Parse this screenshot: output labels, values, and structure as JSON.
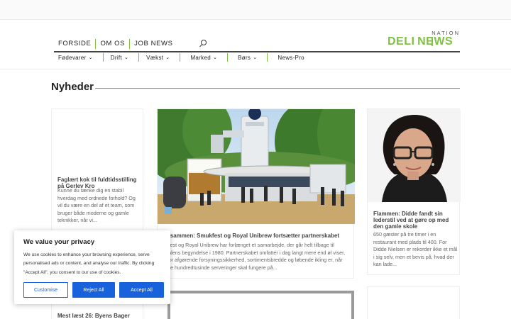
{
  "header": {
    "nav": [
      "FORSIDE",
      "OM OS",
      "JOB NEWS"
    ],
    "logo": {
      "top": "NATION",
      "left": "DELI",
      "right": "NEWS"
    },
    "subnav": [
      {
        "label": "Fødevarer",
        "has_dropdown": true
      },
      {
        "label": "Drift",
        "has_dropdown": true
      },
      {
        "label": "Vækst",
        "has_dropdown": true
      },
      {
        "label": "Marked",
        "has_dropdown": true
      },
      {
        "label": "Børs",
        "has_dropdown": true
      },
      {
        "label": "News-Pro",
        "has_dropdown": false
      }
    ],
    "caret": "⌄"
  },
  "section": {
    "title": "Nyheder"
  },
  "articles": {
    "left": {
      "title": "Faglært kok til fuldtidsstilling på Gerlev Kro",
      "excerpt": "Kunne du tænke dig en stabil hverdag med ordnede forhold? Og vil du være en del af et team, som bruger både moderne og gamle teknikker, når vi..."
    },
    "middle": {
      "title": "år sammen: Smukfest og Royal Unibrew fortsætter partnerskabet",
      "excerpt": "ukfest og Royal Unibrew har forlænget et samarbejde, der går helt tilbage til tivalens begyndelse i 1980. Partnerskabet omfatter i dag langt mere end øl viser, hvor afgørende forsyningssikkerhed, sortimentsbredde og løbende ikling er, når flere hundredtusinde serveringer skal fungere på..."
    },
    "right": {
      "title": "Flammen: Didde fandt sin lederstil ved at gøre op med den gamle skole",
      "excerpt": "650 gæster på tre timer i en restaurant med plads til 400. For Didde Nielsen er rekorder ikke et mål i sig selv, men et bevis på, hvad der kan lade..."
    },
    "left2": {
      "title": "Mest læst 26: Byens Bager"
    }
  },
  "cookie": {
    "title": "We value your privacy",
    "text": "We use cookies to enhance your browsing experience, serve personalised ads or content, and analyse our traffic. By clicking \"Accept All\", you consent to our use of cookies.",
    "buttons": {
      "customise": "Customise",
      "reject": "Reject All",
      "accept": "Accept All"
    }
  },
  "colors": {
    "brand_green": "#7fc241",
    "cookie_blue": "#1863dc"
  }
}
